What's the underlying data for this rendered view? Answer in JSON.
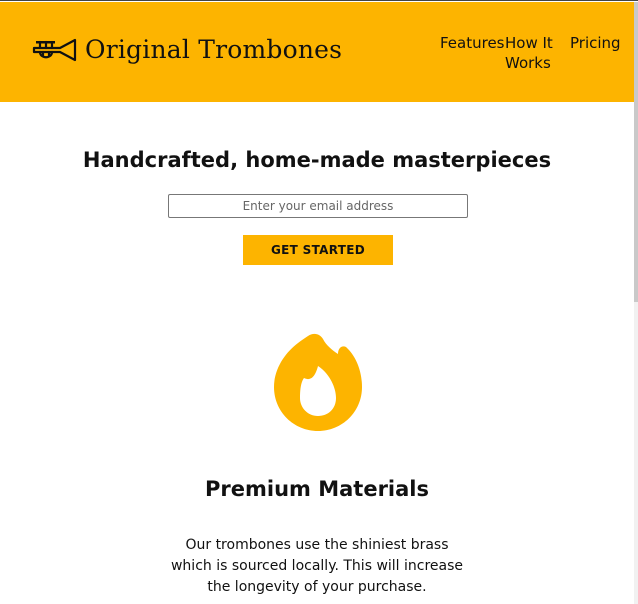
{
  "header": {
    "brand": "Original Trombones",
    "nav": {
      "features": "Features",
      "how_it_works": "How It Works",
      "pricing": "Pricing"
    }
  },
  "hero": {
    "title": "Handcrafted, home-made masterpieces",
    "email_placeholder": "Enter your email address",
    "cta_label": "GET STARTED"
  },
  "feature": {
    "icon": "flame-icon",
    "title": "Premium Materials",
    "description": "Our trombones use the shiniest brass which is sourced locally. This will increase the longevity of your purchase."
  },
  "colors": {
    "accent": "#fdb400",
    "text": "#111111",
    "background": "#ffffff"
  }
}
